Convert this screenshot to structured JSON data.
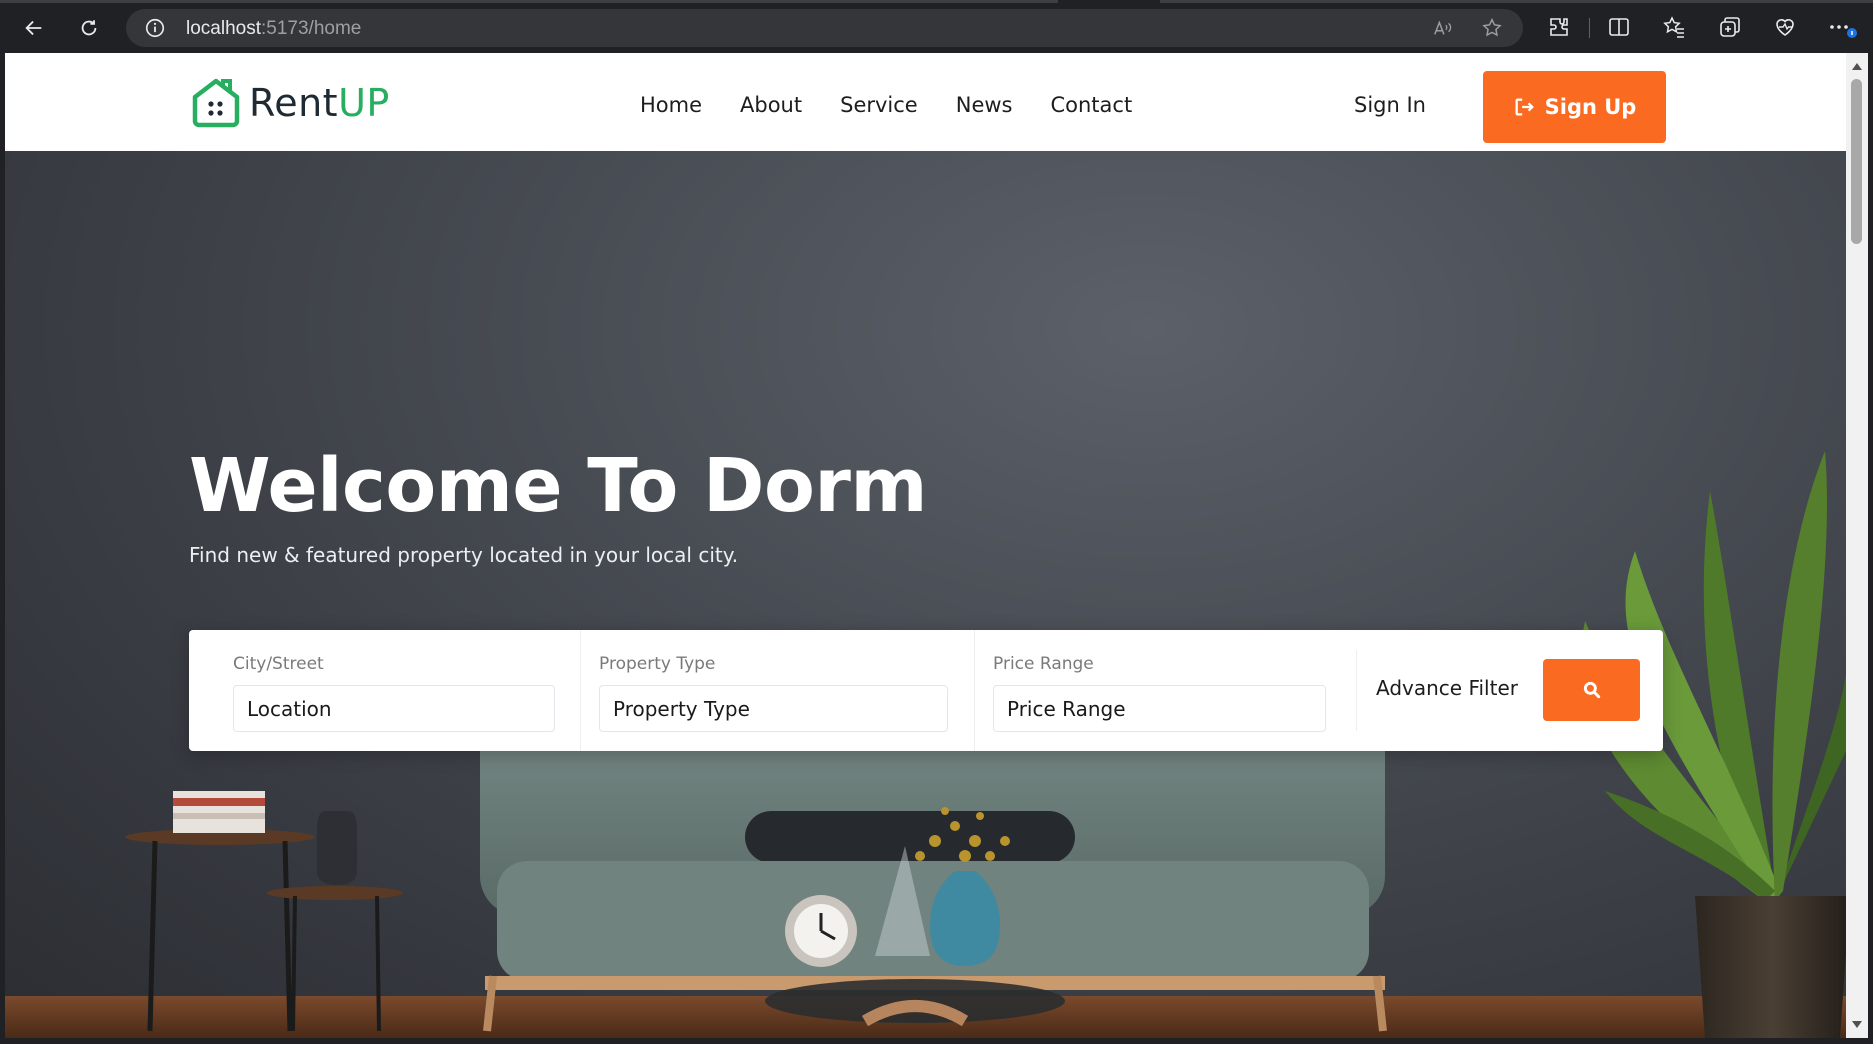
{
  "browser": {
    "url_host": "localhost",
    "url_path": ":5173/home",
    "icons": [
      "back-icon",
      "reload-icon",
      "site-info-icon",
      "read-aloud-icon",
      "favorite-star-icon",
      "extensions-icon",
      "split-screen-icon",
      "favorites-icon",
      "collections-icon",
      "browser-essentials-icon",
      "more-menu-icon"
    ]
  },
  "site": {
    "brand_main": "Rent",
    "brand_accent": "UP",
    "nav": [
      "Home",
      "About",
      "Service",
      "News",
      "Contact"
    ],
    "signin_label": "Sign In",
    "signup_label": "Sign Up"
  },
  "hero": {
    "title": "Welcome To Dorm",
    "subtitle": "Find new & featured property located in your local city."
  },
  "search": {
    "fields": [
      {
        "label": "City/Street",
        "placeholder": "Location"
      },
      {
        "label": "Property Type",
        "placeholder": "Property Type"
      },
      {
        "label": "Price Range",
        "placeholder": "Price Range"
      }
    ],
    "advance_filter_label": "Advance Filter"
  },
  "colors": {
    "brand_green": "#27ae60",
    "accent_orange": "#fb6a21",
    "hero_wall": "#474b52"
  }
}
